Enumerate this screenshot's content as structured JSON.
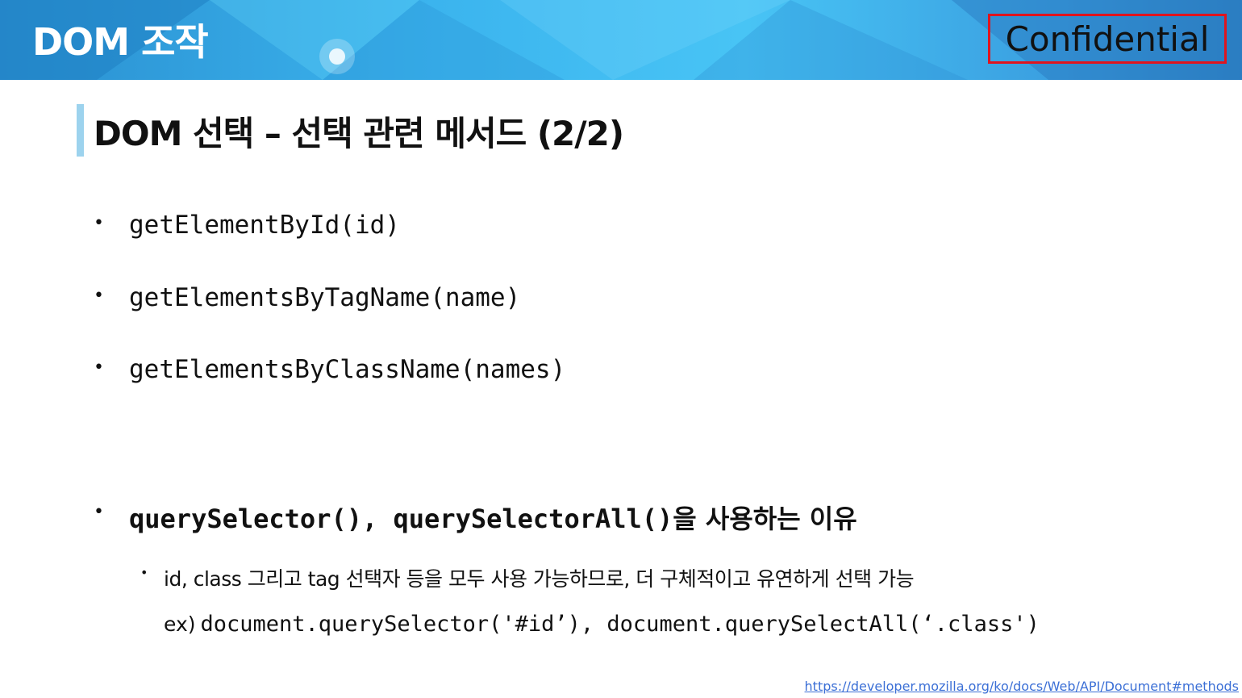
{
  "header": {
    "section_title": "DOM 조작",
    "confidential_label": "Confidential"
  },
  "slide": {
    "title": "DOM 선택 – 선택 관련 메서드 (2/2)",
    "methods": [
      "getElementById(id)",
      "getElementsByTagName(name)",
      "getElementsByClassName(names)"
    ],
    "query_item": {
      "code": "querySelector(), querySelectorAll()",
      "suffix": "을 사용하는 이유"
    },
    "sub_point": "id, class 그리고 tag 선택자 등을 모두 사용 가능하므로, 더 구체적이고 유연하게 선택 가능",
    "example": {
      "prefix": "ex)",
      "code": "document.querySelector('#id’), document.querySelectAll(‘.class')"
    },
    "bullet_glyph": "•"
  },
  "footer": {
    "reference_url": "https://developer.mozilla.org/ko/docs/Web/API/Document#methods"
  },
  "colors": {
    "banner_start": "#2a8fd0",
    "banner_mid": "#48c4f5",
    "title_accent": "#9dd3ee",
    "confidential_border": "#e0141e",
    "link": "#3b6fd6"
  }
}
